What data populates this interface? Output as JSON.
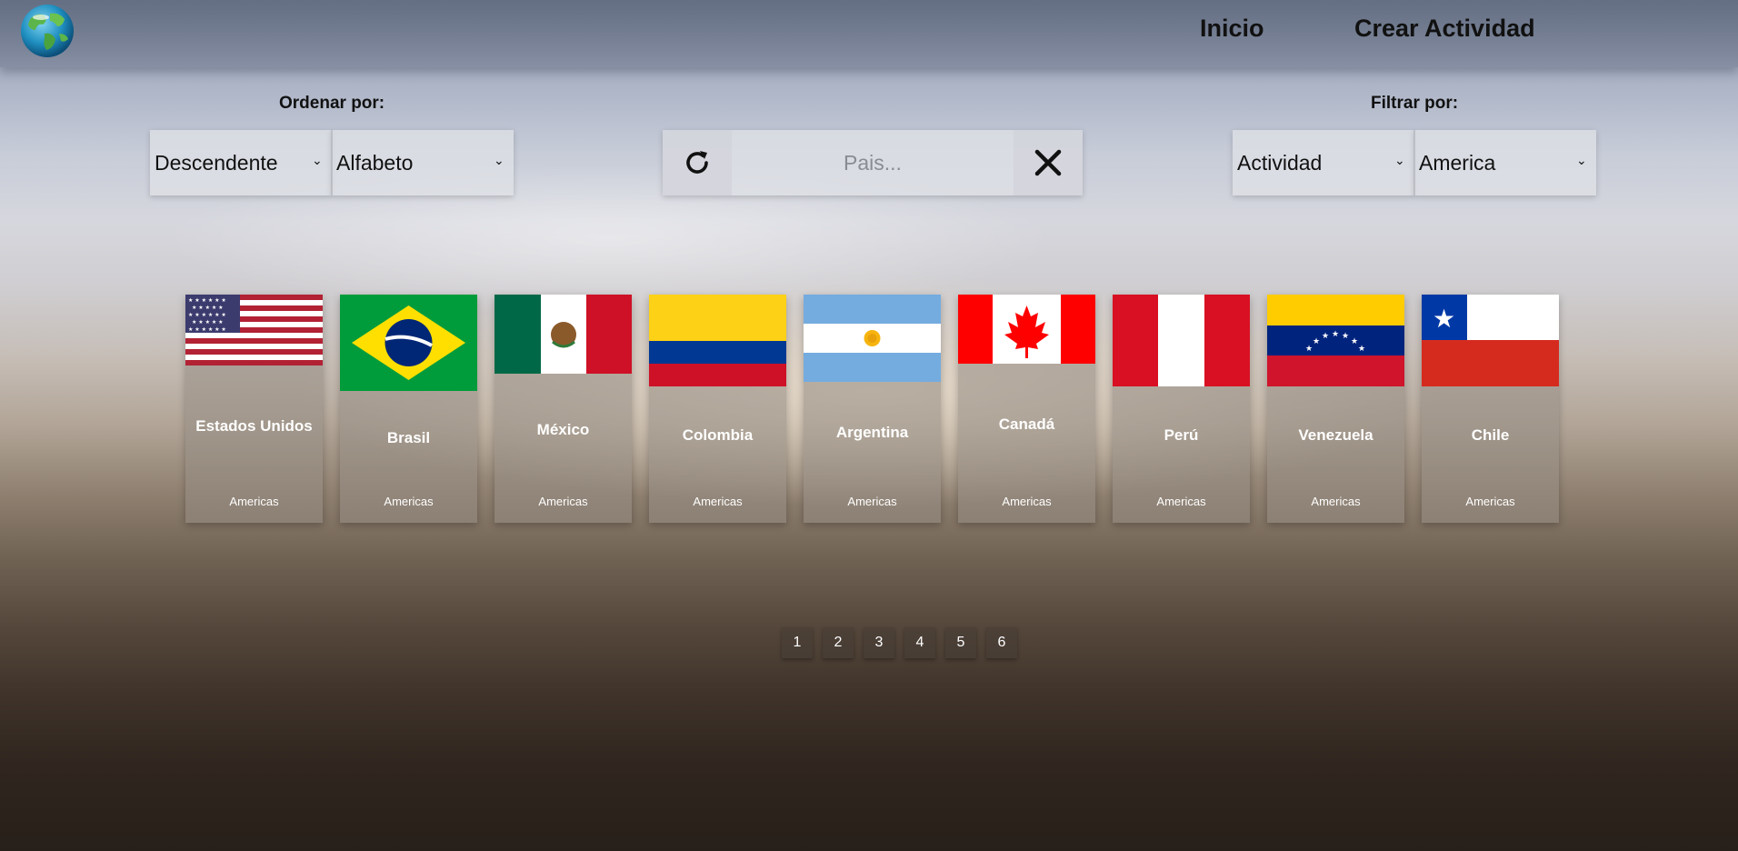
{
  "nav": {
    "home_label": "Inicio",
    "create_label": "Crear Actividad"
  },
  "sort": {
    "label": "Ordenar por:",
    "order_value": "Descendente",
    "field_value": "Alfabeto"
  },
  "search": {
    "placeholder": "Pais..."
  },
  "filter": {
    "label": "Filtrar por:",
    "type_value": "Actividad",
    "continent_value": "America"
  },
  "countries": [
    {
      "name": "Estados Unidos",
      "continent": "Americas",
      "flag": "usa-flag"
    },
    {
      "name": "Brasil",
      "continent": "Americas",
      "flag": "brazil-flag"
    },
    {
      "name": "México",
      "continent": "Americas",
      "flag": "mexico-flag"
    },
    {
      "name": "Colombia",
      "continent": "Americas",
      "flag": "colombia-flag"
    },
    {
      "name": "Argentina",
      "continent": "Americas",
      "flag": "argentina-flag"
    },
    {
      "name": "Canadá",
      "continent": "Americas",
      "flag": "canada-flag"
    },
    {
      "name": "Perú",
      "continent": "Americas",
      "flag": "peru-flag"
    },
    {
      "name": "Venezuela",
      "continent": "Americas",
      "flag": "venezuela-flag"
    },
    {
      "name": "Chile",
      "continent": "Americas",
      "flag": "chile-flag"
    }
  ],
  "pagination": {
    "pages": [
      "1",
      "2",
      "3",
      "4",
      "5",
      "6"
    ]
  },
  "icons": {
    "logo": "globe-logo",
    "reset": "refresh-icon",
    "clear": "close-icon",
    "dropdown": "chevron-down-icon"
  }
}
